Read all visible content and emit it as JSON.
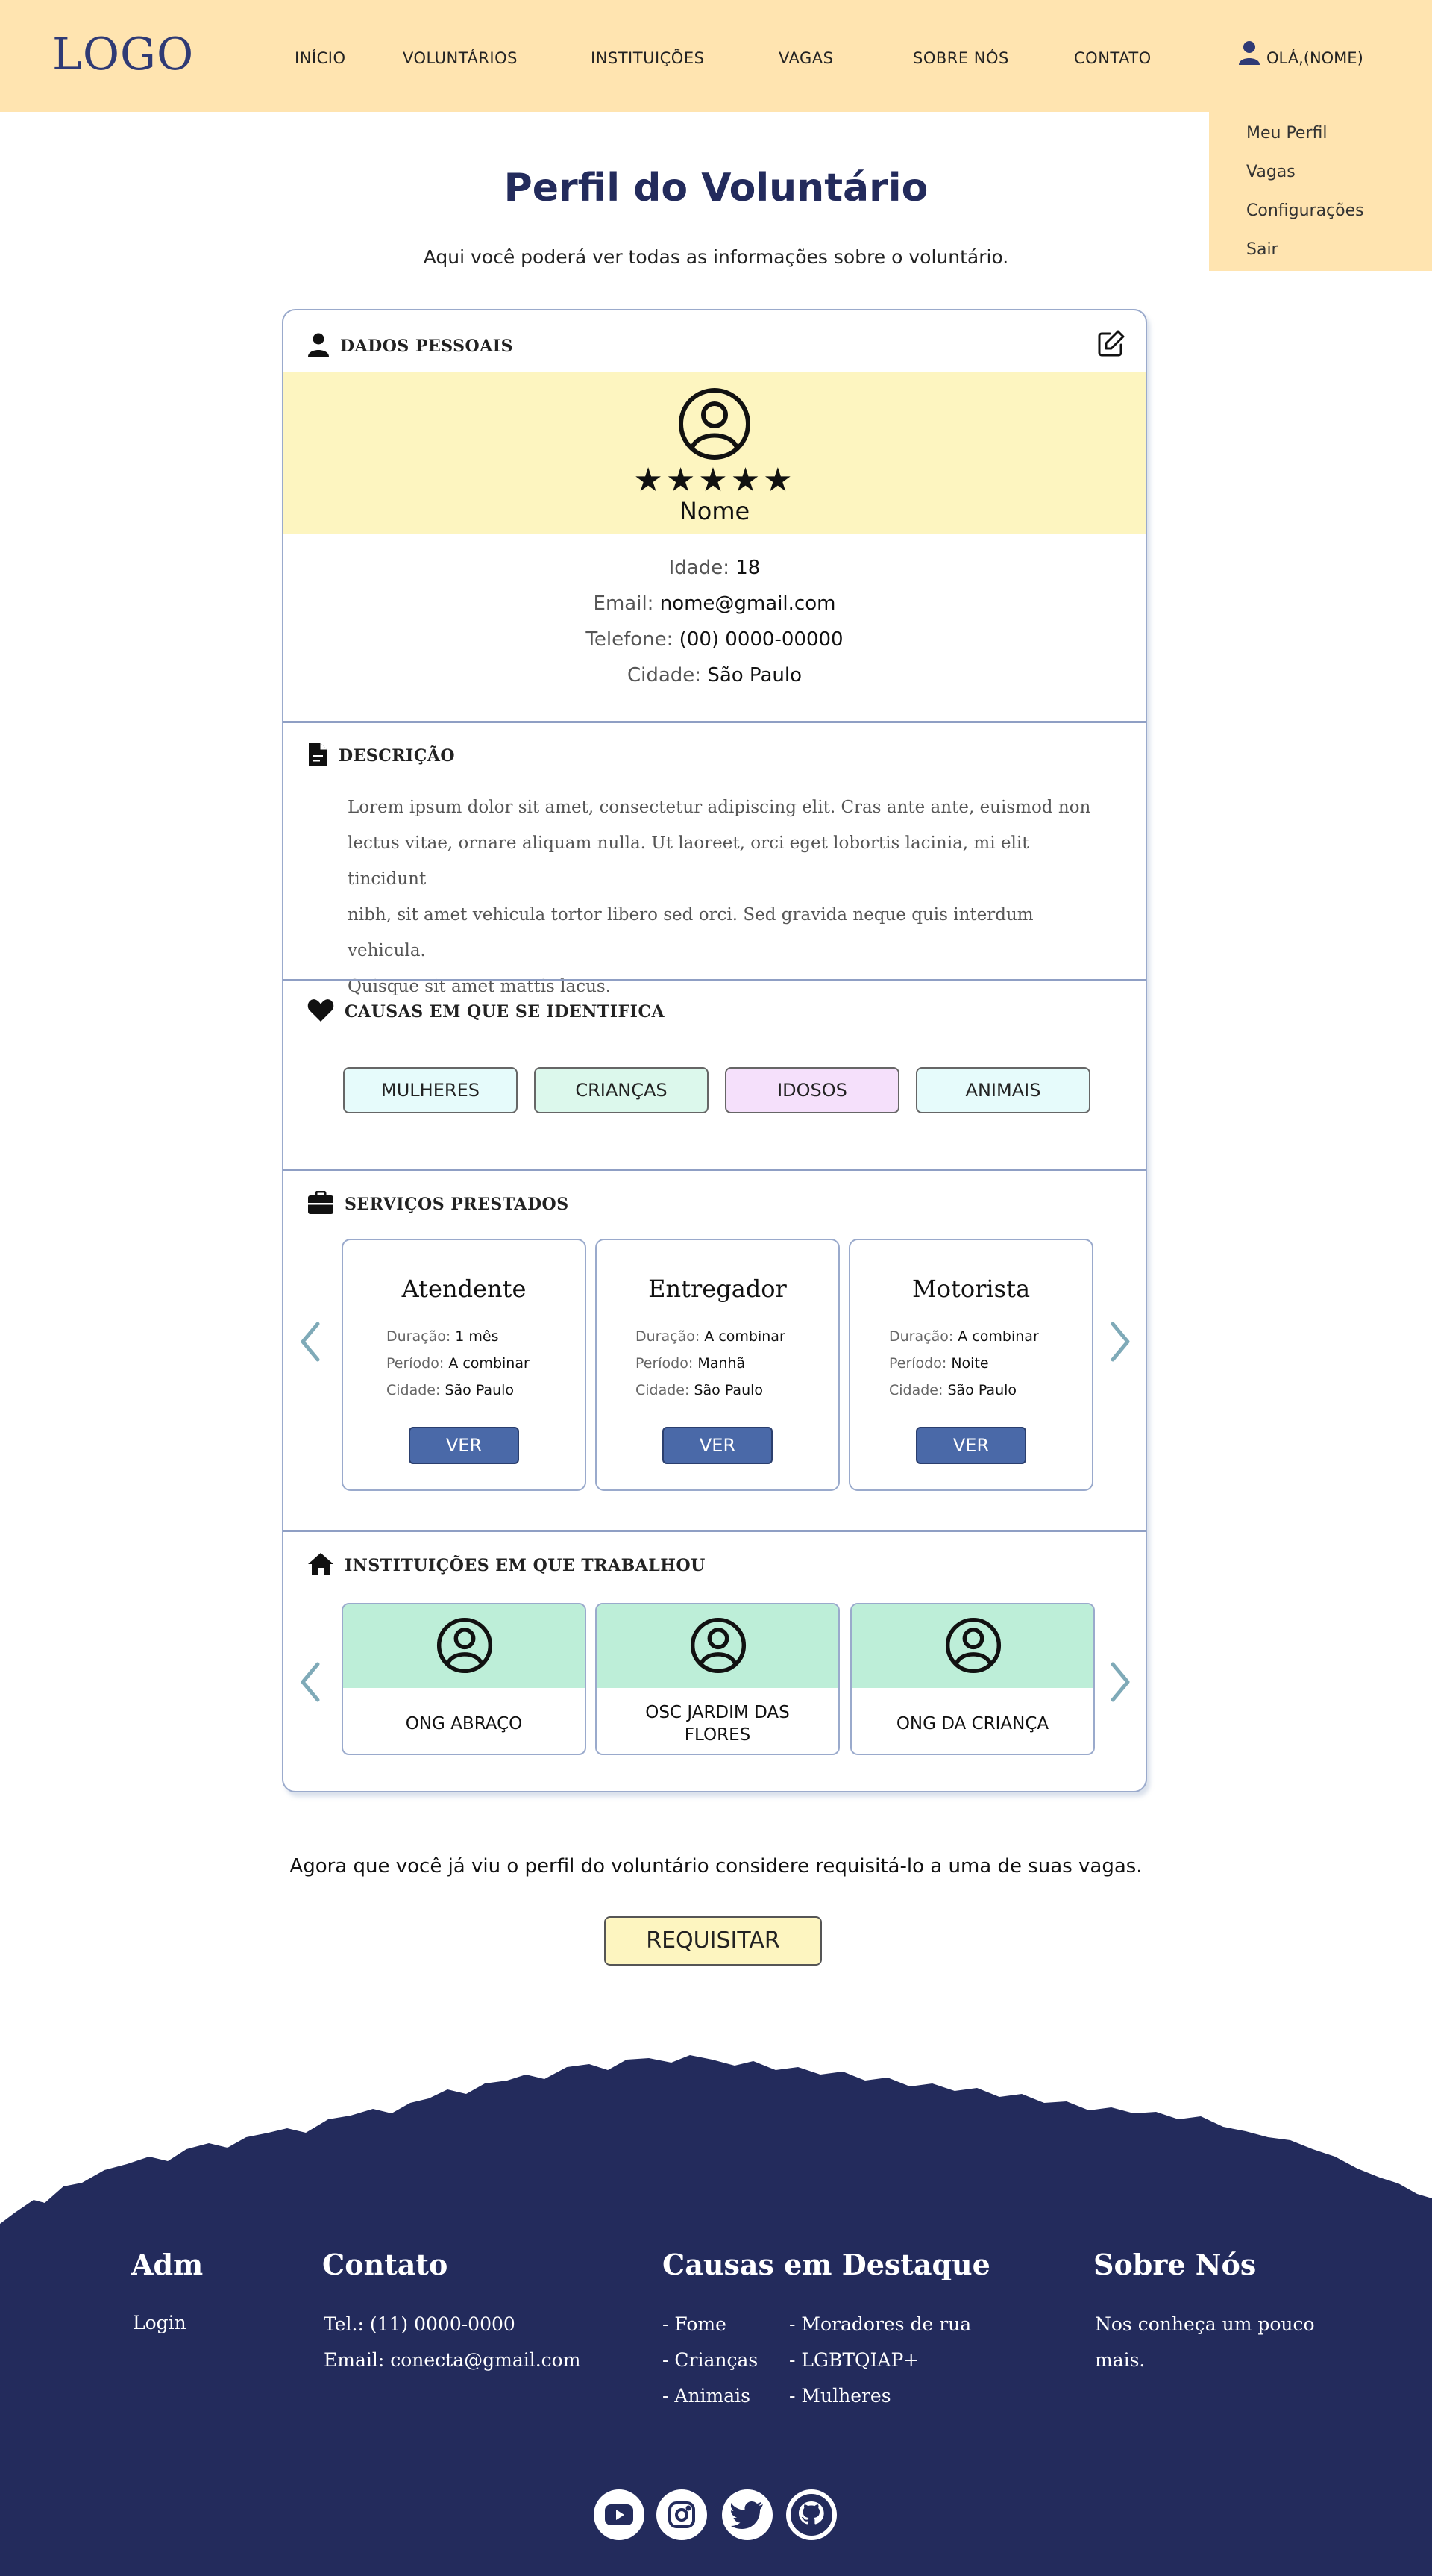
{
  "header": {
    "logo": "LOGO",
    "nav": [
      "INÍCIO",
      "VOLUNTÁRIOS",
      "INSTITUIÇÕES",
      "VAGAS",
      "SOBRE NÓS",
      "CONTATO"
    ],
    "greeting": "OLÁ,(NOME)",
    "user_icon": "user-icon"
  },
  "dropdown": [
    "Meu Perfil",
    "Vagas",
    "Configurações",
    "Sair"
  ],
  "page": {
    "title": "Perfil do Voluntário",
    "subtitle": "Aqui você poderá ver todas as informações sobre o voluntário."
  },
  "personal": {
    "heading": "DADOS PESSOAIS",
    "rating_stars": 5,
    "stars": "★★★★★",
    "name": "Nome",
    "fields": [
      {
        "label": "Idade:",
        "value": "18"
      },
      {
        "label": "Email:",
        "value": "nome@gmail.com"
      },
      {
        "label": "Telefone:",
        "value": "(00) 0000-00000"
      },
      {
        "label": "Cidade:",
        "value": "São Paulo"
      }
    ]
  },
  "description": {
    "heading": "DESCRIÇÃO",
    "lines": [
      "Lorem ipsum dolor sit amet, consectetur adipiscing elit. Cras ante ante, euismod non",
      "lectus vitae, ornare aliquam nulla. Ut laoreet, orci eget lobortis lacinia, mi elit tincidunt",
      "nibh, sit amet vehicula tortor libero sed orci. Sed gravida neque quis interdum vehicula.",
      "Quisque sit amet mattis lacus."
    ]
  },
  "causes": {
    "heading": "CAUSAS EM QUE SE IDENTIFICA",
    "tags": [
      {
        "label": "MULHERES",
        "color": "#e6fbfb"
      },
      {
        "label": "CRIANÇAS",
        "color": "#dcf8ec"
      },
      {
        "label": "IDOSOS",
        "color": "#f5e0fb"
      },
      {
        "label": "ANIMAIS",
        "color": "#e6fbfb"
      }
    ]
  },
  "services": {
    "heading": "SERVIÇOS PRESTADOS",
    "labels": {
      "duration": "Duração:",
      "period": "Período:",
      "city": "Cidade:"
    },
    "button": "VER",
    "items": [
      {
        "title": "Atendente",
        "duration": "1 mês",
        "period": "A combinar",
        "city": "São Paulo"
      },
      {
        "title": "Entregador",
        "duration": "A combinar",
        "period": "Manhã",
        "city": "São Paulo"
      },
      {
        "title": "Motorista",
        "duration": "A combinar",
        "period": "Noite",
        "city": "São Paulo"
      }
    ]
  },
  "institutions": {
    "heading": "INSTITUIÇÕES EM QUE TRABALHOU",
    "items": [
      "ONG ABRAÇO",
      "OSC JARDIM DAS FLORES",
      "ONG DA CRIANÇA"
    ]
  },
  "cta": {
    "text": "Agora que você já viu o perfil do voluntário considere requisitá-lo a uma de suas vagas.",
    "button": "REQUISITAR"
  },
  "footer": {
    "adm": {
      "title": "Adm",
      "link": "Login"
    },
    "contact": {
      "title": "Contato",
      "phone": "Tel.: (11) 0000-0000",
      "email": "Email: conecta@gmail.com"
    },
    "causes": {
      "title": "Causas em Destaque",
      "col1": [
        "- Fome",
        "- Crianças",
        "- Animais"
      ],
      "col2": [
        "- Moradores de rua",
        "- LGBTQIAP+",
        "- Mulheres"
      ]
    },
    "about": {
      "title": "Sobre Nós",
      "lines": [
        "Nos conheça um pouco",
        "mais."
      ]
    },
    "social": [
      "youtube-icon",
      "instagram-icon",
      "twitter-icon",
      "github-icon"
    ]
  },
  "colors": {
    "header_bg": "#ffe4b0",
    "navy": "#232b5c",
    "profile_band": "#fdf5c0",
    "institution_band": "#bdeed8",
    "button_blue": "#4a69a8",
    "arrow": "#7faab8"
  }
}
